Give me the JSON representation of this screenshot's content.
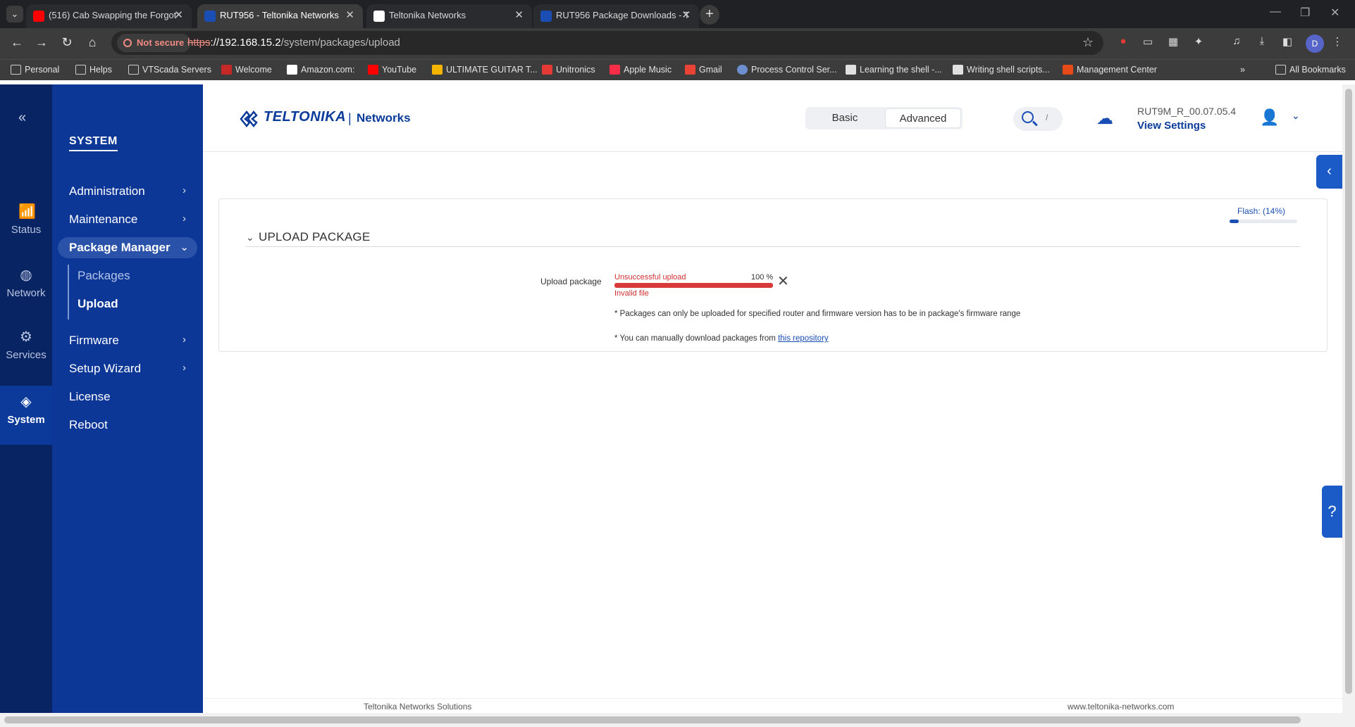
{
  "browser": {
    "tabs": [
      {
        "title": "(516) Cab Swapping the Forgot",
        "fav_color": "#ff0000",
        "active": false
      },
      {
        "title": "RUT956 - Teltonika Networks",
        "fav_color": "#1a4eb5",
        "active": true
      },
      {
        "title": "Teltonika Networks",
        "fav_color": "#ffffff",
        "active": false
      },
      {
        "title": "RUT956 Package Downloads - T",
        "fav_color": "#1a4eb5",
        "active": false
      }
    ],
    "new_tab": "+",
    "security_label": "Not secure",
    "url_protocol": "https",
    "url_host": "://192.168.15.2",
    "url_path": "/system/packages/upload",
    "profile_initial": "D",
    "bookmarks": [
      {
        "label": "Personal",
        "type": "folder"
      },
      {
        "label": "Helps",
        "type": "folder"
      },
      {
        "label": "VTScada Servers",
        "type": "folder"
      },
      {
        "label": "Welcome",
        "type": "site",
        "color": "#c62828"
      },
      {
        "label": "Amazon.com:",
        "type": "site",
        "color": "#ffffff"
      },
      {
        "label": "YouTube",
        "type": "site",
        "color": "#ff0000"
      },
      {
        "label": "ULTIMATE GUITAR T...",
        "type": "site",
        "color": "#f4b400"
      },
      {
        "label": "Unitronics",
        "type": "site",
        "color": "#e53935"
      },
      {
        "label": "Apple Music",
        "type": "site",
        "color": "#fa2d48"
      },
      {
        "label": "Gmail",
        "type": "site",
        "color": "#ea4335"
      },
      {
        "label": "Process Control Ser...",
        "type": "site",
        "color": "#6b8fcf"
      },
      {
        "label": "Learning the shell -...",
        "type": "site",
        "color": "#e0e0e0"
      },
      {
        "label": "Writing shell scripts...",
        "type": "site",
        "color": "#e0e0e0"
      },
      {
        "label": "Management Center",
        "type": "site",
        "color": "#e64a19"
      }
    ],
    "all_bookmarks": "All Bookmarks"
  },
  "rail": {
    "items": [
      {
        "label": "Status",
        "icon": "bar-chart-icon",
        "glyph": "📶"
      },
      {
        "label": "Network",
        "icon": "globe-icon",
        "glyph": "◍"
      },
      {
        "label": "Services",
        "icon": "gear-icon",
        "glyph": "⚙"
      },
      {
        "label": "System",
        "icon": "system-icon",
        "glyph": "◈"
      }
    ]
  },
  "sidenav": {
    "title": "SYSTEM",
    "items": [
      {
        "label": "Administration",
        "chevron": true
      },
      {
        "label": "Maintenance",
        "chevron": true
      },
      {
        "label": "Package Manager",
        "chevron": true
      },
      {
        "label": "Firmware",
        "chevron": true
      },
      {
        "label": "Setup Wizard",
        "chevron": true
      },
      {
        "label": "License",
        "chevron": false
      },
      {
        "label": "Reboot",
        "chevron": false
      }
    ],
    "sub_items": [
      {
        "label": "Packages"
      },
      {
        "label": "Upload"
      }
    ]
  },
  "header": {
    "logo_word": "TELTONIKA",
    "logo_sep": "|",
    "logo_sub": "Networks",
    "mode_basic": "Basic",
    "mode_advanced": "Advanced",
    "search_shortcut": "/",
    "firmware": "RUT9M_R_00.07.05.4",
    "view_settings": "View Settings"
  },
  "card": {
    "flash_label": "Flash: (14%)",
    "flash_percent": 14,
    "section_title": "UPLOAD PACKAGE",
    "row_label": "Upload package",
    "upload_status": "Unsuccessful upload",
    "upload_percent_text": "100 %",
    "upload_percent": 100,
    "upload_error": "Invalid file",
    "note1": "* Packages can only be uploaded for specified router and firmware version has to be in package's firmware range",
    "note2_prefix": "* You can manually download packages from ",
    "note2_link": "this repository"
  },
  "footer": {
    "left": "Teltonika Networks Solutions",
    "right": "www.teltonika-networks.com"
  },
  "colors": {
    "rail": "#092462",
    "sidenav": "#0c3797",
    "accent": "#1a4eb5",
    "error": "#d83a3a"
  }
}
